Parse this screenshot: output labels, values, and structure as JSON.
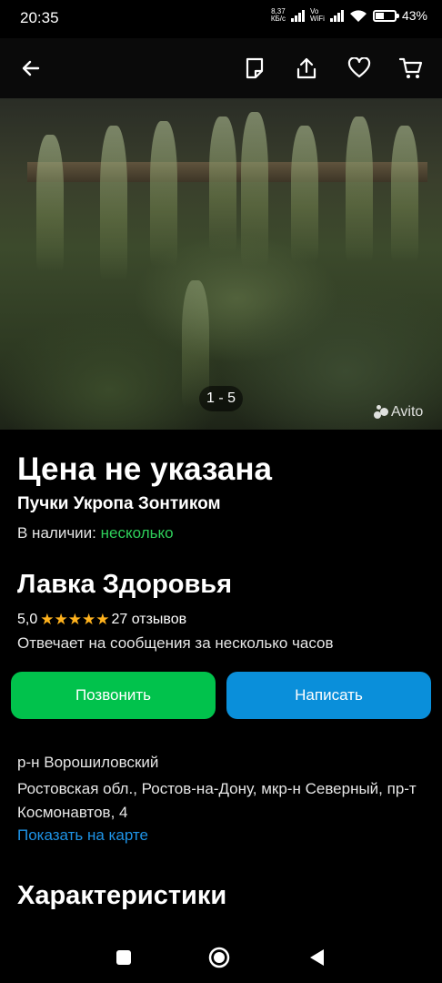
{
  "status_bar": {
    "time": "20:35",
    "speed_value": "8,37",
    "speed_unit": "КБ/с",
    "vo": "Vo",
    "wifi_label": "WiFi",
    "battery": "43%"
  },
  "app_bar": {
    "icons": [
      "back-arrow-icon",
      "note-icon",
      "share-icon",
      "heart-icon",
      "cart-icon"
    ]
  },
  "gallery": {
    "counter": "1 - 5",
    "watermark": "Avito"
  },
  "listing": {
    "price": "Цена не указана",
    "title": "Пучки Укропа Зонтиком",
    "availability_label": "В наличии:",
    "availability_value": "несколько"
  },
  "seller": {
    "name": "Лавка Здоровья",
    "rating": "5,0",
    "stars": "★★★★★",
    "reviews": "27 отзывов",
    "response_time": "Отвечает на сообщения за несколько часов"
  },
  "actions": {
    "call_label": "Позвонить",
    "write_label": "Написать"
  },
  "address": {
    "district": "р-н Ворошиловский",
    "full": "Ростовская обл., Ростов-на-Дону, мкр-н Северный, пр-т Космонавтов, 4",
    "map_link": "Показать на карте"
  },
  "section": {
    "characteristics": "Характеристики"
  },
  "colors": {
    "call_button": "#01c24c",
    "write_button": "#0a8fda",
    "availability_green": "#2ecf5a",
    "link_blue": "#1e93e6",
    "star": "#ffb21d"
  }
}
